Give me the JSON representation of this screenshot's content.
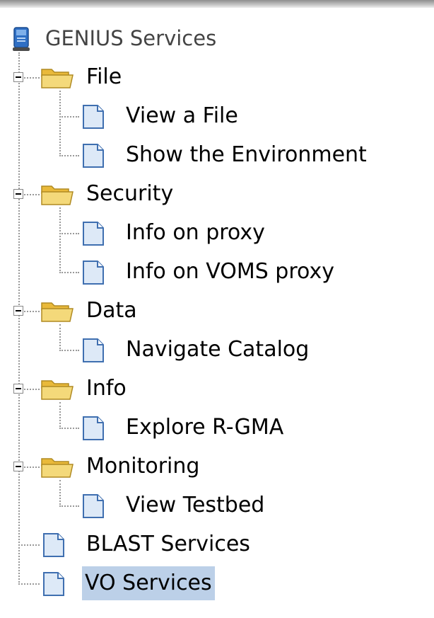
{
  "tree": {
    "root": {
      "label": "GENIUS Services",
      "icon": "computer-icon"
    },
    "folders": [
      {
        "label": "File",
        "icon": "folder-open-icon",
        "expanded": true,
        "items": [
          {
            "label": "View a File"
          },
          {
            "label": "Show the Environment"
          }
        ]
      },
      {
        "label": "Security",
        "icon": "folder-open-icon",
        "expanded": true,
        "items": [
          {
            "label": "Info on proxy"
          },
          {
            "label": "Info on VOMS proxy"
          }
        ]
      },
      {
        "label": "Data",
        "icon": "folder-open-icon",
        "expanded": true,
        "items": [
          {
            "label": "Navigate Catalog"
          }
        ]
      },
      {
        "label": "Info",
        "icon": "folder-open-icon",
        "expanded": true,
        "items": [
          {
            "label": "Explore R-GMA"
          }
        ]
      },
      {
        "label": "Monitoring",
        "icon": "folder-open-icon",
        "expanded": true,
        "items": [
          {
            "label": "View Testbed"
          }
        ]
      }
    ],
    "leaves": [
      {
        "label": "BLAST Services",
        "icon": "document-icon"
      },
      {
        "label": "VO Services",
        "icon": "document-icon",
        "selected": true
      }
    ]
  },
  "colors": {
    "selection": "#bcd0e8",
    "folder": "#f2d36b",
    "document": "#cfe0f5"
  }
}
